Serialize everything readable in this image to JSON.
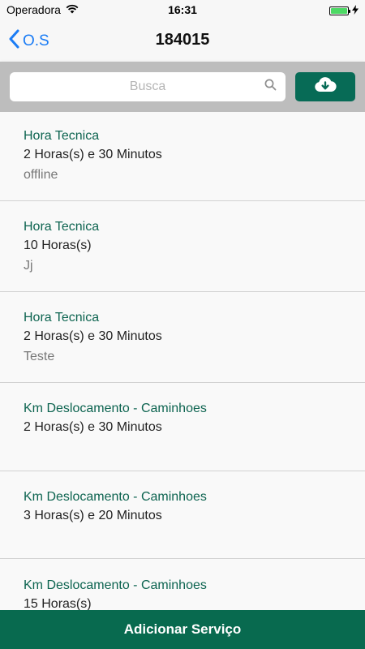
{
  "status_bar": {
    "carrier": "Operadora",
    "time": "16:31"
  },
  "nav": {
    "back_label": "O.S",
    "title": "184015"
  },
  "search": {
    "placeholder": "Busca",
    "value": ""
  },
  "items": [
    {
      "title": "Hora Tecnica",
      "duration": "2 Horas(s) e 30 Minutos",
      "note": "offline"
    },
    {
      "title": "Hora Tecnica",
      "duration": "10 Horas(s)",
      "note": "Jj"
    },
    {
      "title": "Hora Tecnica",
      "duration": "2 Horas(s) e 30 Minutos",
      "note": "Teste"
    },
    {
      "title": "Km Deslocamento - Caminhoes",
      "duration": "2 Horas(s) e 30 Minutos",
      "note": ""
    },
    {
      "title": "Km Deslocamento - Caminhoes",
      "duration": "3 Horas(s) e 20 Minutos",
      "note": ""
    },
    {
      "title": "Km Deslocamento - Caminhoes",
      "duration": "15 Horas(s)",
      "note": ""
    }
  ],
  "footer": {
    "add_label": "Adicionar Serviço"
  },
  "colors": {
    "accent": "#086a4f",
    "link": "#1a7cf5",
    "item_title": "#0d6450"
  }
}
